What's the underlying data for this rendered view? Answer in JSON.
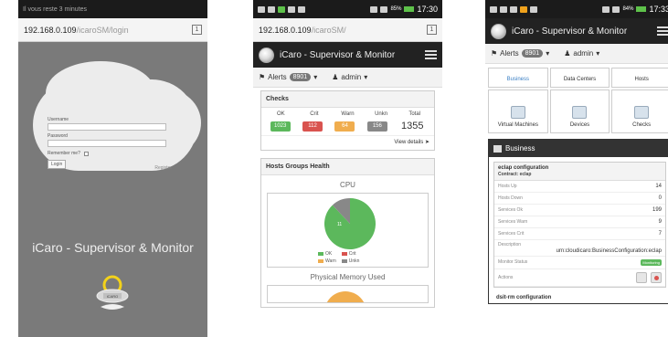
{
  "phone1": {
    "status_notice": "Il vous reste 3 minutes",
    "url_host": "192.168.0.109",
    "url_path": "/icaroSM/login",
    "tabs_count": "1",
    "login": {
      "username_label": "Username",
      "password_label": "Password",
      "remember_label": "Remember me?",
      "login_button": "Login",
      "register_link": "Register"
    },
    "brand_title": "iCaro - Supervisor & Monitor",
    "mascot_label": "iCARO"
  },
  "phone2": {
    "clock": "17:30",
    "battery": "85%",
    "url_host": "192.168.0.109",
    "url_path": "/icaroSM/",
    "tabs_count": "1",
    "app_title": "iCaro - Supervisor & Monitor",
    "alerts_label": "Alerts",
    "alerts_count": "8901",
    "user_label": "admin",
    "checks": {
      "title": "Checks",
      "headers": [
        "OK",
        "Crit",
        "Warn",
        "Unkn",
        "Total"
      ],
      "ok": "1023",
      "crit": "112",
      "warn": "64",
      "unkn": "156",
      "total": "1355",
      "view_details": "View details"
    },
    "hosts_health_title": "Hosts Groups Health",
    "chart_cpu_title": "CPU",
    "chart_mem_title": "Physical Memory Used",
    "legend": {
      "ok": "OK",
      "crit": "Crit",
      "warn": "Warn",
      "unkn": "Unkn"
    },
    "pie_label": "11",
    "colors": {
      "ok": "#5cb85c",
      "crit": "#d9534f",
      "warn": "#f0ad4e",
      "unkn": "#888888"
    }
  },
  "chart_data": {
    "type": "pie",
    "title": "CPU",
    "categories": [
      "OK",
      "Crit",
      "Warn",
      "Unkn"
    ],
    "values": [
      88,
      0,
      0,
      12
    ]
  },
  "phone3": {
    "clock": "17:33",
    "battery": "84%",
    "app_title": "iCaro - Supervisor & Monitor",
    "alerts_label": "Alerts",
    "alerts_count": "8901",
    "user_label": "admin",
    "tiles": [
      "Business",
      "Data Centers",
      "Hosts",
      "Virtual Machines",
      "Devices",
      "Checks"
    ],
    "business_title": "Business",
    "config": {
      "title": "eclap configuration",
      "contract": "Contract: eclap",
      "rows": [
        {
          "k": "Hosts Up",
          "v": "14"
        },
        {
          "k": "Hosts Down",
          "v": "0"
        },
        {
          "k": "Services Ok",
          "v": "199"
        },
        {
          "k": "Services Warn",
          "v": "9"
        },
        {
          "k": "Services Crit",
          "v": "7"
        }
      ],
      "description_label": "Description",
      "description_value": "urn:cloudicaro:BusinessConfiguration:eclap",
      "monitor_status_label": "Monitor Status",
      "monitor_status_value": "Monitoring",
      "actions_label": "Actions"
    },
    "next_title": "dsit-rm configuration"
  }
}
